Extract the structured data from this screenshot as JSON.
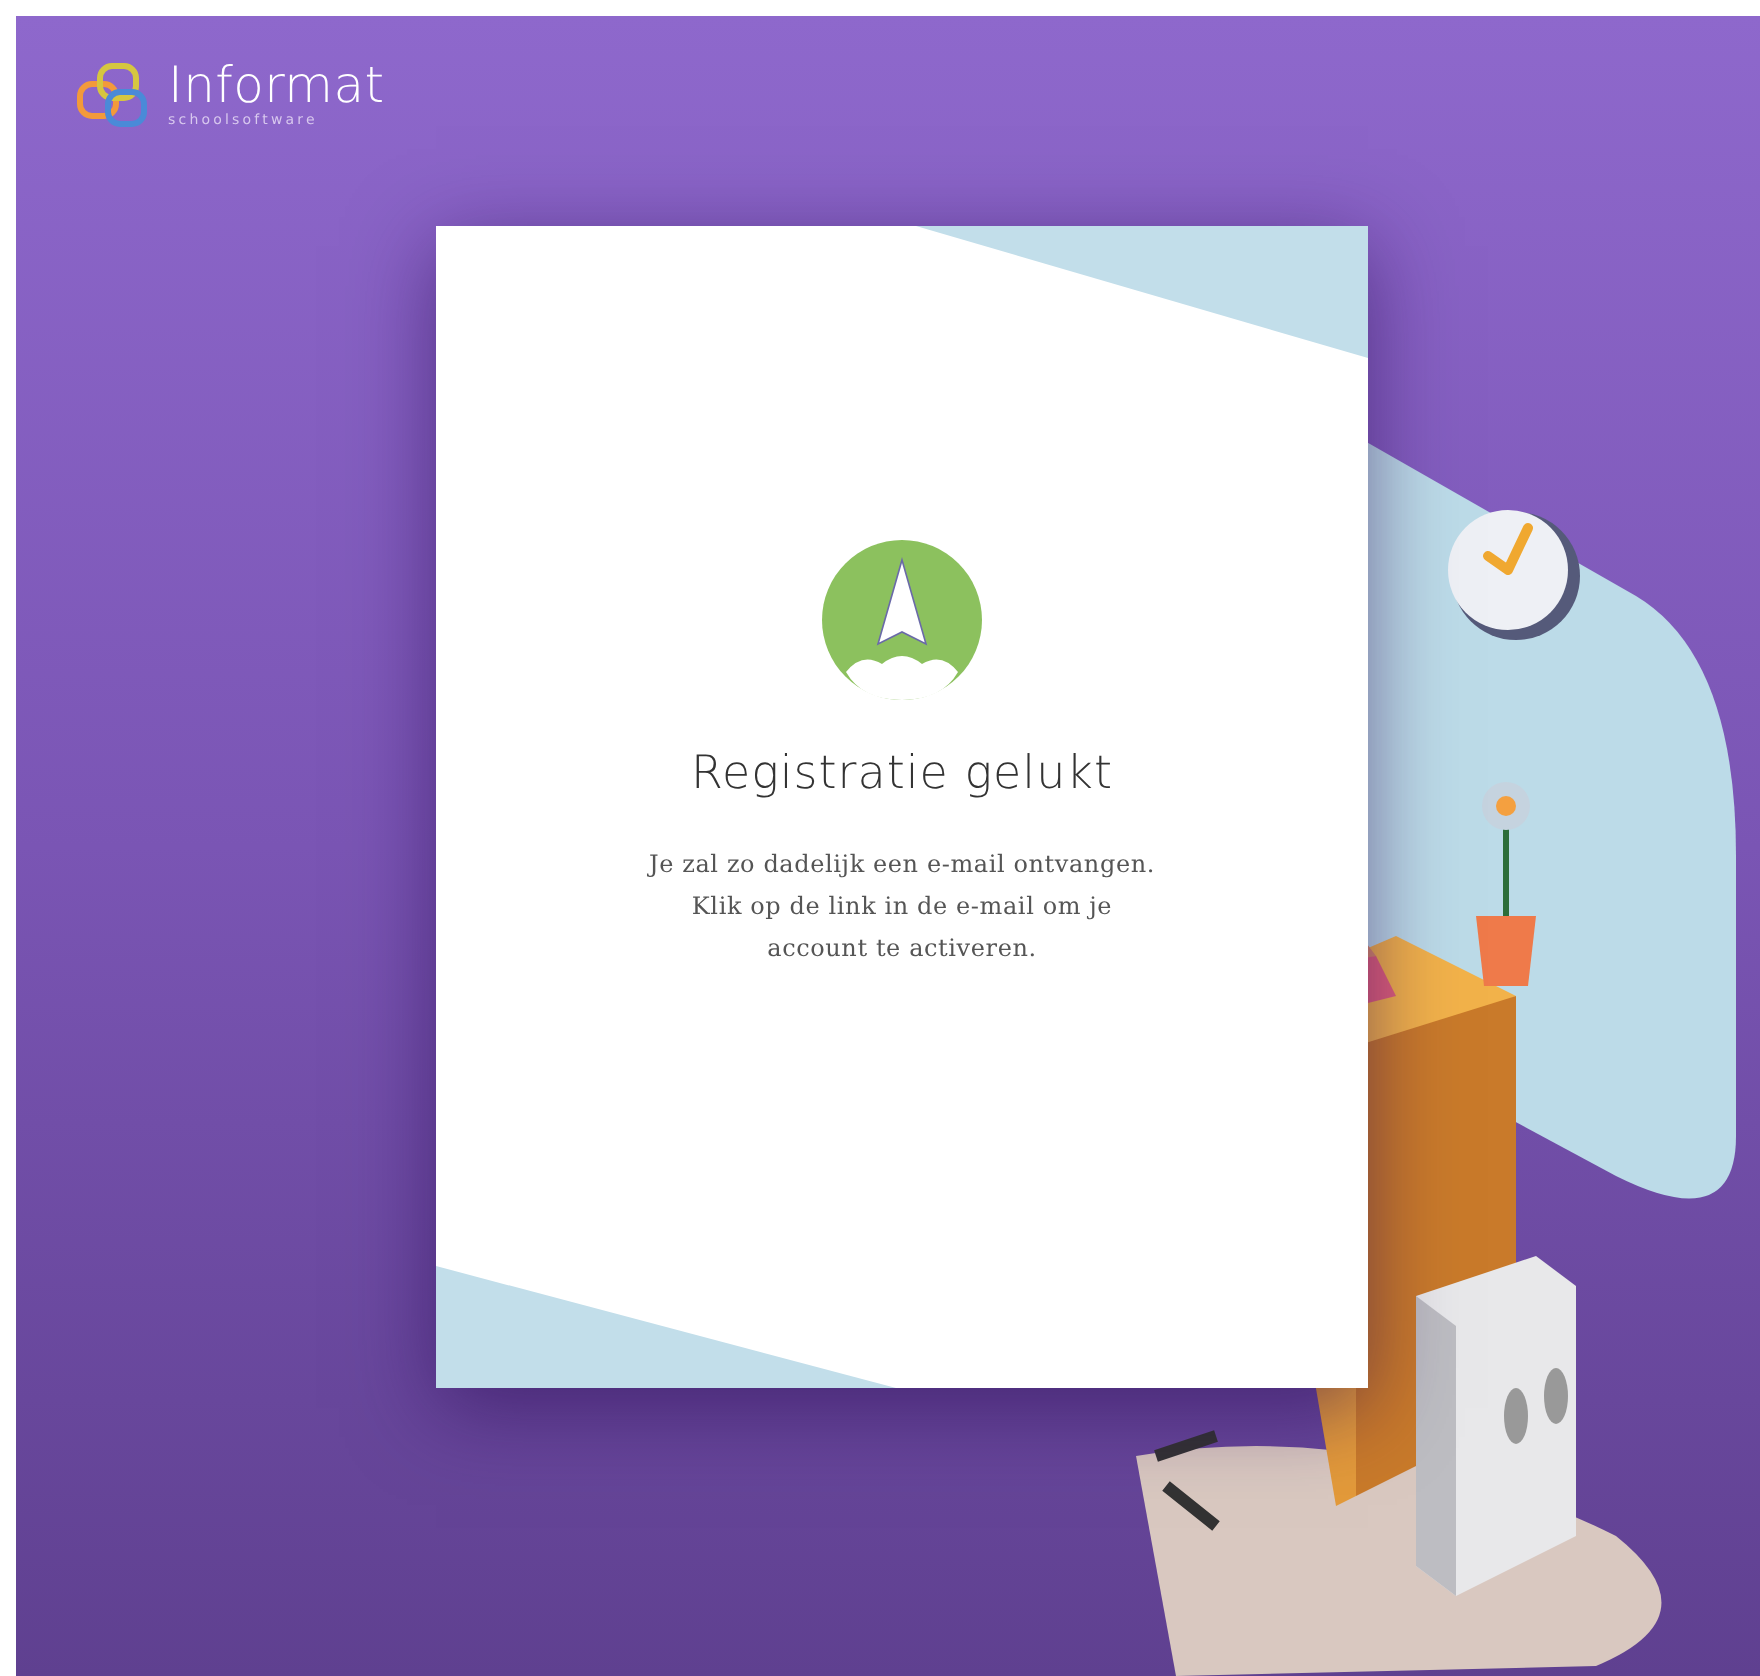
{
  "logo": {
    "name": "Informat",
    "tagline": "schoolsoftware"
  },
  "card": {
    "title": "Registratie gelukt",
    "message": "Je zal zo dadelijk een e-mail ontvangen. Klik op de link in de e-mail om je account te activeren."
  }
}
